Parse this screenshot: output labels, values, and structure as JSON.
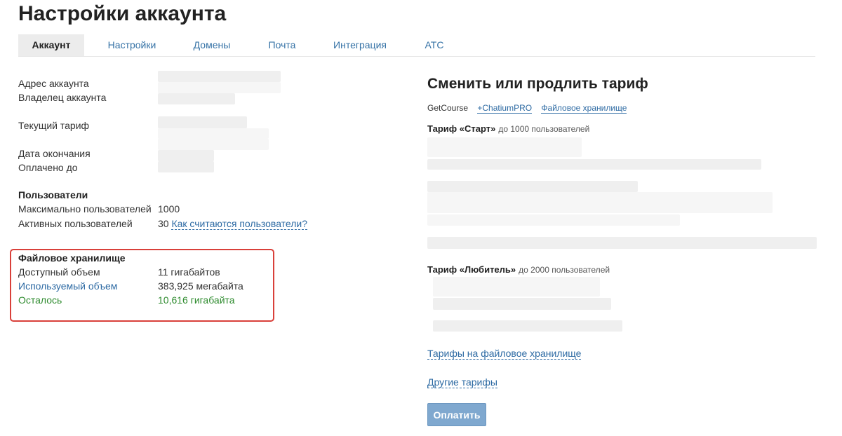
{
  "page": {
    "title": "Настройки аккаунта"
  },
  "tabs": [
    {
      "label": "Аккаунт",
      "active": true
    },
    {
      "label": "Настройки"
    },
    {
      "label": "Домены"
    },
    {
      "label": "Почта"
    },
    {
      "label": "Интеграция"
    },
    {
      "label": "АТС"
    }
  ],
  "account": {
    "address_label": "Адрес аккаунта",
    "owner_label": "Владелец аккаунта",
    "tariff_label": "Текущий тариф",
    "end_date_label": "Дата окончания",
    "paid_until_label": "Оплачено до"
  },
  "users": {
    "heading": "Пользователи",
    "max_label": "Максимально пользователей",
    "max_value": "1000",
    "active_label": "Активных пользователей",
    "active_value": "30",
    "how_link": "Как считаются пользователи?"
  },
  "storage": {
    "heading": "Файловое хранилище",
    "available_label": "Доступный объем",
    "available_value": "11 гигабайтов",
    "used_label": "Используемый объем",
    "used_value": "383,925 мегабайта",
    "left_label": "Осталось",
    "left_value": "10,616 гигабайта"
  },
  "tariffs": {
    "title": "Сменить или продлить тариф",
    "products": [
      "GetCourse",
      "+ChatiumPRO",
      "Файловое хранилище"
    ],
    "plans": [
      {
        "name": "Тариф «Старт»",
        "users": "до 1000 пользователей"
      },
      {
        "name": "Тариф «Любитель»",
        "users": "до 2000 пользователей"
      }
    ],
    "storage_link": "Тарифы на файловое хранилище",
    "other_link": "Другие тарифы",
    "pay_button": "Оплатить"
  },
  "colors": {
    "accent": "#2d6aa3",
    "remaining": "#2e8b2e",
    "highlight_border": "#d9403a",
    "button": "#7fa8cf"
  }
}
